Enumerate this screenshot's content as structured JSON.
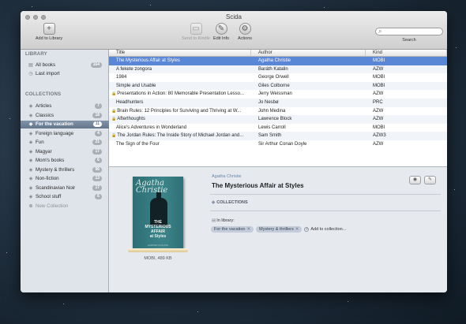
{
  "window": {
    "title": "Scida"
  },
  "toolbar": {
    "add_label": "Add to Library",
    "send_label": "Send to Kindle",
    "edit_label": "Edit Info",
    "actions_label": "Actions",
    "search_label": "Search",
    "search_value": "",
    "search_placeholder": ""
  },
  "sidebar": {
    "library_header": "LIBRARY",
    "library": [
      {
        "label": "All books",
        "count": "164"
      },
      {
        "label": "Last import",
        "count": ""
      }
    ],
    "collections_header": "COLLECTIONS",
    "collections": [
      {
        "label": "Articles",
        "count": "7"
      },
      {
        "label": "Classics",
        "count": "18"
      },
      {
        "label": "For the vacation",
        "count": "11"
      },
      {
        "label": "Foreign language",
        "count": "4"
      },
      {
        "label": "Fun",
        "count": "21"
      },
      {
        "label": "Magyar",
        "count": "17"
      },
      {
        "label": "Mom's books",
        "count": "6"
      },
      {
        "label": "Mystery & thrillers",
        "count": "96"
      },
      {
        "label": "Non-fiction",
        "count": "13"
      },
      {
        "label": "Scandinavian Noir",
        "count": "17"
      },
      {
        "label": "School stuff",
        "count": "6"
      }
    ],
    "new_collection": "New Collection"
  },
  "book_list": {
    "columns": [
      "Title",
      "Author",
      "Kind"
    ],
    "rows": [
      {
        "title": "The Mysterious Affair at Styles",
        "author": "Agatha Christie",
        "kind": "MOBI",
        "locked": false
      },
      {
        "title": "A fekete zongora",
        "author": "Baráth Katalin",
        "kind": "AZW",
        "locked": false
      },
      {
        "title": "1984",
        "author": "George Orwell",
        "kind": "MOBI",
        "locked": false
      },
      {
        "title": "Simple and Usable",
        "author": "Giles Colborne",
        "kind": "MOBI",
        "locked": false
      },
      {
        "title": "Presentations in Action: 80 Memorable Presentation Lesso...",
        "author": "Jerry Weissman",
        "kind": "AZW",
        "locked": true
      },
      {
        "title": "Headhunters",
        "author": "Jo Nesbø",
        "kind": "PRC",
        "locked": false
      },
      {
        "title": "Brain Rules: 12 Principles for Surviving and Thriving at W...",
        "author": "John Medina",
        "kind": "AZW",
        "locked": true
      },
      {
        "title": "Afterthoughts",
        "author": "Lawrence Block",
        "kind": "AZW",
        "locked": true
      },
      {
        "title": "Alice's Adventures in Wonderland",
        "author": "Lewis Carroll",
        "kind": "MOBI",
        "locked": false
      },
      {
        "title": "The Jordan Rules: The Inside Story of Michael Jordan and...",
        "author": "Sam Smith",
        "kind": "AZW3",
        "locked": true
      },
      {
        "title": "The Sign of the Four",
        "author": "Sir Arthur Conan Doyle",
        "kind": "AZW",
        "locked": false
      }
    ]
  },
  "detail": {
    "author": "Agatha Christie",
    "title": "The Mysterious Affair at Styles",
    "format_size": "MOBI, 489 KB",
    "collections_label": "COLLECTIONS",
    "in_library_label": "In library:",
    "tags": [
      "For the vacation",
      "Mystery & thrillers"
    ],
    "add_to_collection": "Add to collection...",
    "cover": {
      "brand": "Agatha Christie",
      "title_lines": [
        "THE",
        "MYSTERIOUS",
        "AFFAIR",
        "at Styles"
      ],
      "footer": "HARPER COLLINS"
    }
  }
}
